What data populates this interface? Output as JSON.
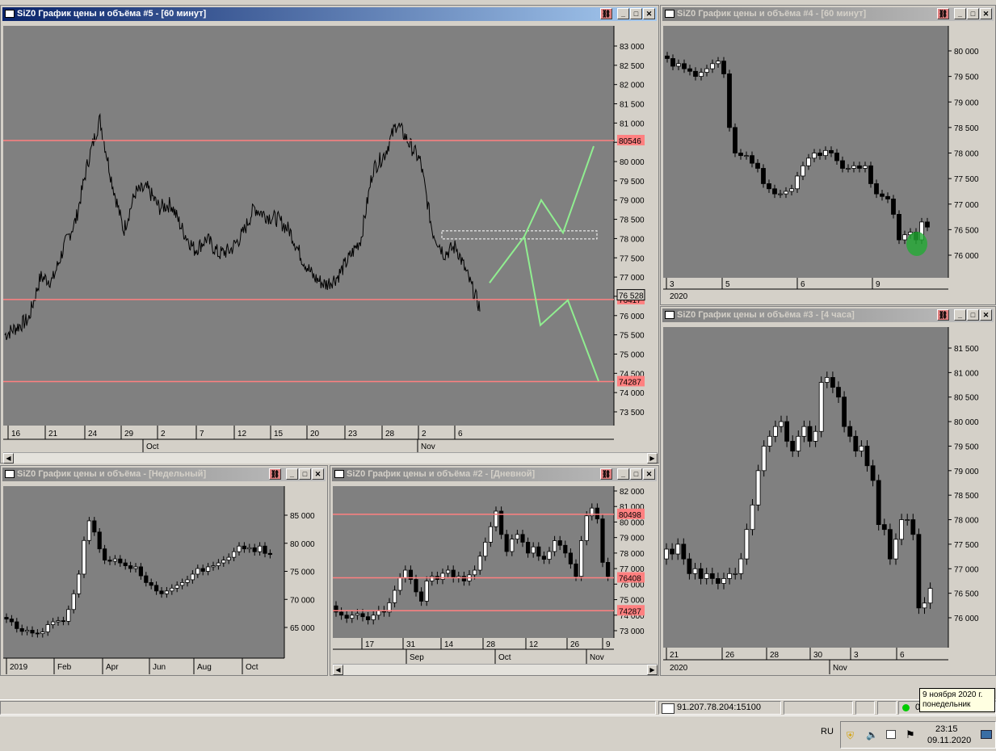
{
  "windows": {
    "w5": {
      "title": "SiZ0 График цены и объёма #5 - [60 минут]",
      "prices": [
        "83 000",
        "82 500",
        "82 000",
        "81 500",
        "81 000",
        "80 500",
        "80 000",
        "79 500",
        "79 000",
        "78 500",
        "78 000",
        "77 500",
        "77 000",
        "76 500",
        "76 000",
        "75 500",
        "75 000",
        "74 500",
        "74 000",
        "73 500"
      ],
      "levels": [
        "80546",
        "76417",
        "74287"
      ],
      "current": "76 528",
      "days": [
        "16",
        "21",
        "24",
        "29",
        "2",
        "7",
        "12",
        "15",
        "20",
        "23",
        "28",
        "2",
        "6"
      ],
      "months": [
        "Oct",
        "Nov"
      ]
    },
    "w4": {
      "title": "SiZ0 График цены и объёма #4 - [60 минут]",
      "prices": [
        "80 000",
        "79 500",
        "79 000",
        "78 500",
        "78 000",
        "77 500",
        "77 000",
        "76 500",
        "76 000"
      ],
      "days": [
        "3",
        "5",
        "6",
        "9"
      ],
      "year": "2020"
    },
    "w3": {
      "title": "SiZ0 График цены и объёма #3 - [4 часа]",
      "prices": [
        "81 500",
        "81 000",
        "80 500",
        "80 000",
        "79 500",
        "79 000",
        "78 500",
        "78 000",
        "77 500",
        "77 000",
        "76 500",
        "76 000"
      ],
      "days": [
        "21",
        "26",
        "28",
        "30",
        "3",
        "6"
      ],
      "year": "2020",
      "month": "Nov"
    },
    "wWeek": {
      "title": "SiZ0 График цены и объёма - [Недельный]",
      "prices": [
        "85 000",
        "80 000",
        "75 000",
        "70 000",
        "65 000"
      ],
      "months": [
        "2019",
        "Feb",
        "Apr",
        "Jun",
        "Aug",
        "Oct"
      ]
    },
    "w2": {
      "title": "SiZ0 График цены и объёма #2 - [Дневной]",
      "prices": [
        "82 000",
        "81 000",
        "80 000",
        "79 000",
        "78 000",
        "77 000",
        "76 000",
        "75 000",
        "74 000",
        "73 000"
      ],
      "levels": [
        "80498",
        "76408",
        "74287"
      ],
      "days": [
        "17",
        "31",
        "14",
        "28",
        "12",
        "26",
        "9"
      ],
      "months": [
        "Sep",
        "Oct",
        "Nov"
      ]
    }
  },
  "status": {
    "server": "91.207.78.204:15100",
    "connection_indicator": "0"
  },
  "tray": {
    "lang": "RU",
    "time": "23:15",
    "date": "09.11.2020"
  },
  "tooltip": {
    "line1": "9 ноября 2020 г.",
    "line2": "понедельник"
  },
  "colors": {
    "plot_bg": "#808080",
    "level_line": "#ff8080",
    "level_label": "#ff8080",
    "projection": "#90ee90",
    "highlight_green": "#22aa33"
  }
}
